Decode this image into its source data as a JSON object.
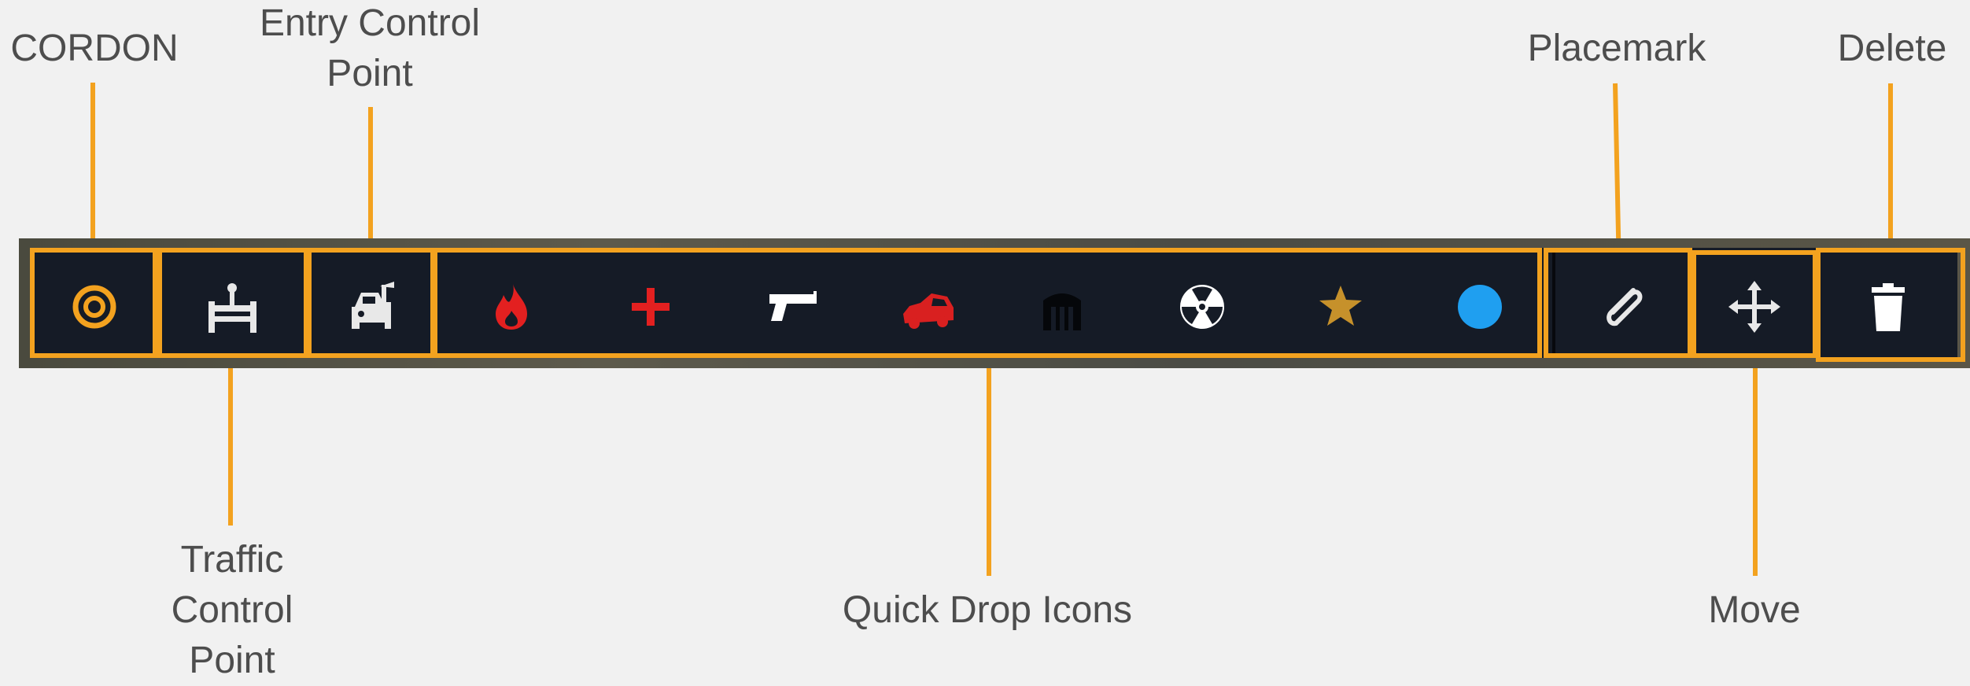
{
  "callouts": {
    "cordon": "CORDON",
    "entry_control_point": [
      "Entry Control",
      "Point"
    ],
    "placemark": "Placemark",
    "delete": "Delete",
    "traffic_control_point": [
      "Traffic",
      "Control",
      "Point"
    ],
    "quick_drop_icons": "Quick Drop Icons",
    "move": "Move"
  },
  "toolbar": {
    "tools": [
      {
        "name": "cordon",
        "icon": "target-icon",
        "color": "#f3a21f"
      },
      {
        "name": "traffic-control-point",
        "icon": "barrier-icon",
        "color": "#e8e8e8"
      },
      {
        "name": "entry-control-point",
        "icon": "vehicle-checkpoint-icon",
        "color": "#e8e8e8"
      }
    ],
    "quick_drop": [
      {
        "icon": "fire-icon",
        "color": "#e32020"
      },
      {
        "icon": "medical-cross-icon",
        "color": "#e32020"
      },
      {
        "icon": "gun-icon",
        "color": "#ffffff"
      },
      {
        "icon": "vehicle-accident-icon",
        "color": "#d92020"
      },
      {
        "icon": "building-icon",
        "color": "#05070a"
      },
      {
        "icon": "radiation-icon",
        "color": "#ffffff"
      },
      {
        "icon": "star-icon",
        "color": "#c6912b"
      },
      {
        "icon": "circle-icon",
        "color": "#1f9ff0"
      }
    ],
    "actions": [
      {
        "name": "placemark",
        "icon": "paperclip-icon",
        "color": "#e8e8e8"
      },
      {
        "name": "move",
        "icon": "move-arrows-icon",
        "color": "#e8e8e8"
      },
      {
        "name": "delete",
        "icon": "trash-icon",
        "color": "#ffffff"
      }
    ]
  },
  "colors": {
    "accent": "#f3a21f",
    "toolbar": "#151b26",
    "background": "#f1f1f1",
    "text": "#4d4d4d"
  }
}
